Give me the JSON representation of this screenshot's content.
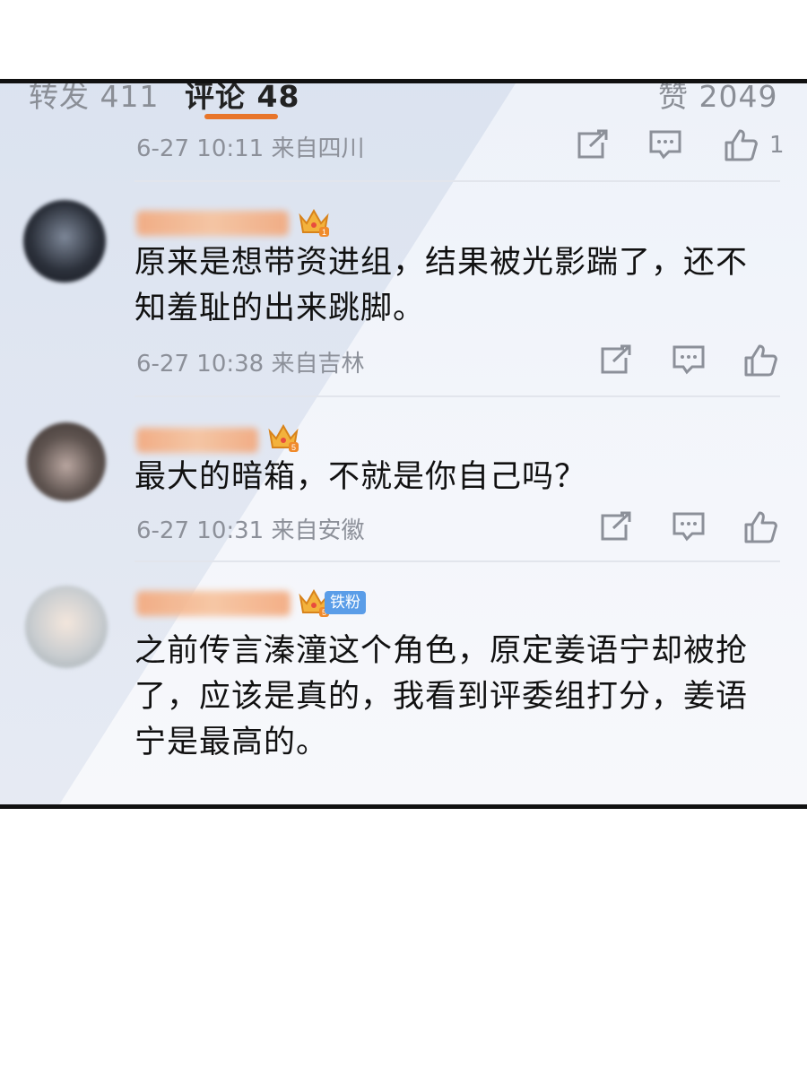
{
  "tabs": {
    "repost": "转发 411",
    "comment": "评论 48",
    "likes": "赞 2049"
  },
  "comments": [
    {
      "meta": "6-27 10:11 来自四川",
      "like_count": "1"
    },
    {
      "user_level": "1",
      "text": "原来是想带资进组，结果被光影踹了，还不知羞耻的出来跳脚。",
      "meta": "6-27 10:38 来自吉林"
    },
    {
      "user_level": "5",
      "text": "最大的暗箱，不就是你自己吗？",
      "meta": "6-27 10:31 来自安徽"
    },
    {
      "user_level": "5",
      "fan_badge": "铁粉",
      "text": "之前传言溱潼这个角色，原定姜语宁却被抢了，应该是真的，我看到评委组打分，姜语宁是最高的。"
    }
  ],
  "icons": {
    "share": "share-icon",
    "reply": "comment-icon",
    "like": "thumbs-up-icon",
    "crown": "crown-icon"
  },
  "colors": {
    "accent": "#e8752a",
    "text": "#111111",
    "meta": "#8c9099"
  }
}
